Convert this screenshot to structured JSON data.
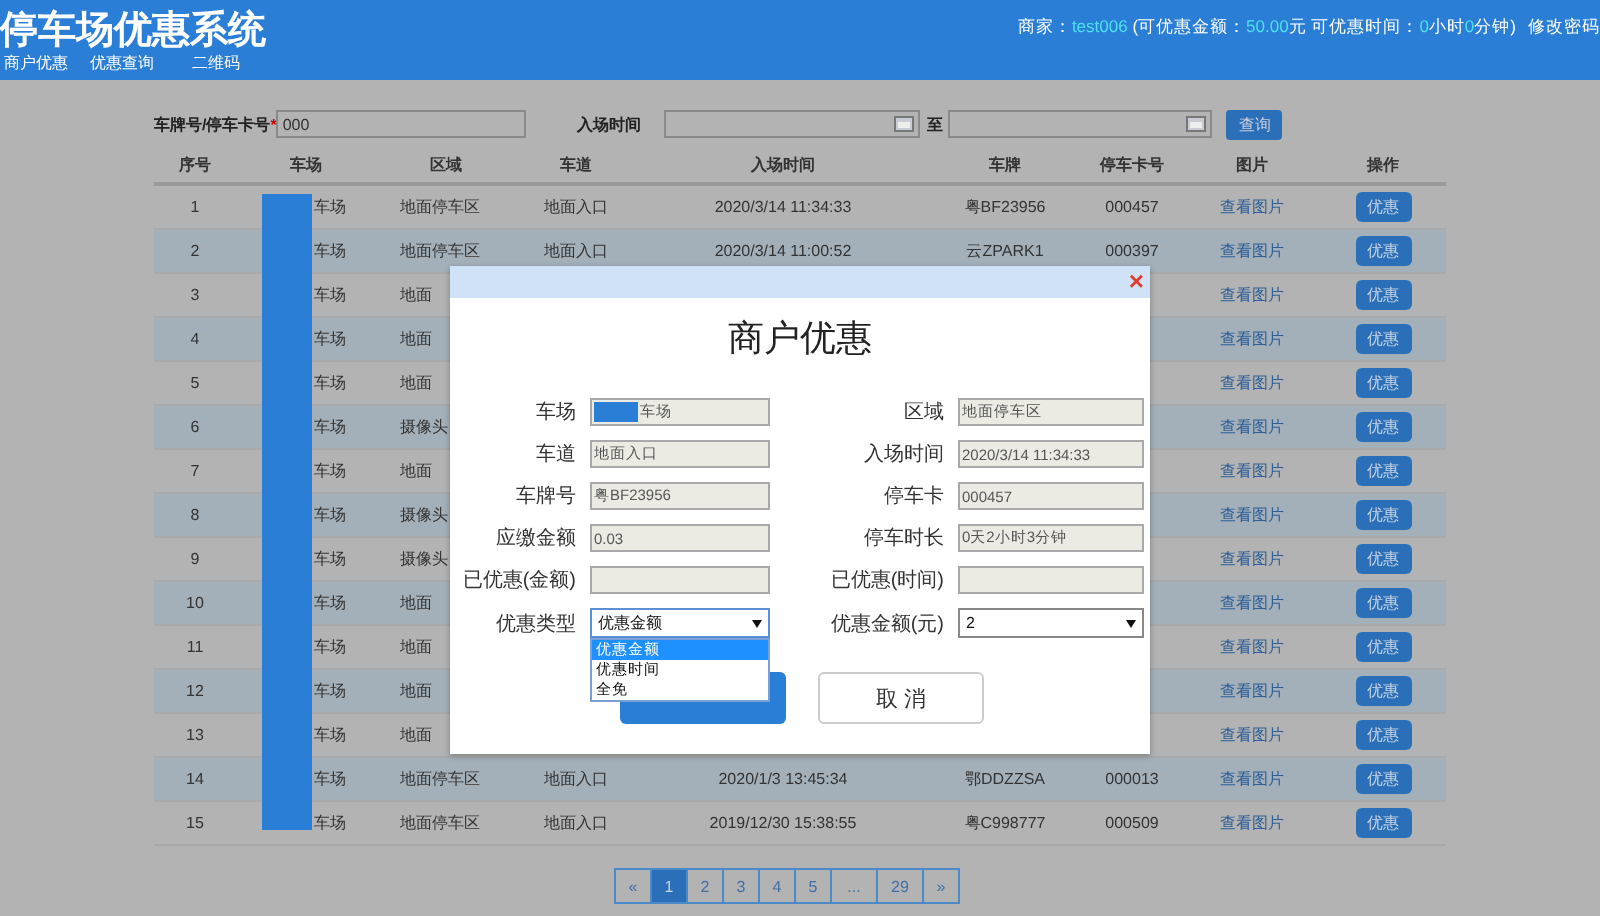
{
  "header": {
    "title": "停车场优惠系统",
    "info": [
      {
        "text": "商家：",
        "highlight": false
      },
      {
        "text": "test006",
        "highlight": true
      },
      {
        "text": " (可优惠金额：",
        "highlight": false
      },
      {
        "text": "50.00",
        "highlight": true
      },
      {
        "text": "元 可优惠时间：",
        "highlight": false
      },
      {
        "text": "0",
        "highlight": true
      },
      {
        "text": "小时",
        "highlight": false
      },
      {
        "text": "0",
        "highlight": true
      },
      {
        "text": "分钟)",
        "highlight": false
      }
    ],
    "change_password": "修改密码",
    "nav": [
      "商户优惠",
      "优惠查询",
      "二维码"
    ]
  },
  "search": {
    "plate_label": "车牌号/停车卡号",
    "required_mark": "*",
    "plate_value": "000",
    "time_label": "入场时间",
    "to_label": "至",
    "button": "查询"
  },
  "table": {
    "columns": [
      "序号",
      "车场",
      "区域",
      "车道",
      "入场时间",
      "车牌",
      "停车卡号",
      "图片",
      "操作"
    ],
    "rows": [
      {
        "no": "1",
        "lot": "车场",
        "area": "地面停车区",
        "lane": "地面入口",
        "time": "2020/3/14 11:34:33",
        "plate": "粤BF23956",
        "card": "000457",
        "picture": "查看图片",
        "action": "优惠"
      },
      {
        "no": "2",
        "lot": "车场",
        "area": "地面停车区",
        "lane": "地面入口",
        "time": "2020/3/14 11:00:52",
        "plate": "云ZPARK1",
        "card": "000397",
        "picture": "查看图片",
        "action": "优惠"
      },
      {
        "no": "3",
        "lot": "车场",
        "area": "地面",
        "picture": "查看图片",
        "action": "优惠"
      },
      {
        "no": "4",
        "lot": "车场",
        "area": "地面",
        "picture": "查看图片",
        "action": "优惠"
      },
      {
        "no": "5",
        "lot": "车场",
        "area": "地面",
        "picture": "查看图片",
        "action": "优惠"
      },
      {
        "no": "6",
        "lot": "车场",
        "area": "摄像头",
        "picture": "查看图片",
        "action": "优惠"
      },
      {
        "no": "7",
        "lot": "车场",
        "area": "地面",
        "picture": "查看图片",
        "action": "优惠"
      },
      {
        "no": "8",
        "lot": "车场",
        "area": "摄像头",
        "picture": "查看图片",
        "action": "优惠"
      },
      {
        "no": "9",
        "lot": "车场",
        "area": "摄像头",
        "picture": "查看图片",
        "action": "优惠"
      },
      {
        "no": "10",
        "lot": "车场",
        "area": "地面",
        "picture": "查看图片",
        "action": "优惠"
      },
      {
        "no": "11",
        "lot": "车场",
        "area": "地面",
        "picture": "查看图片",
        "action": "优惠"
      },
      {
        "no": "12",
        "lot": "车场",
        "area": "地面",
        "picture": "查看图片",
        "action": "优惠"
      },
      {
        "no": "13",
        "lot": "车场",
        "area": "地面",
        "picture": "查看图片",
        "action": "优惠"
      },
      {
        "no": "14",
        "lot": "车场",
        "area": "地面停车区",
        "lane": "地面入口",
        "time": "2020/1/3 13:45:34",
        "plate": "鄂DDZZSA",
        "card": "000013",
        "picture": "查看图片",
        "action": "优惠"
      },
      {
        "no": "15",
        "lot": "车场",
        "area": "地面停车区",
        "lane": "地面入口",
        "time": "2019/12/30 15:38:55",
        "plate": "粤C998777",
        "card": "000509",
        "picture": "查看图片",
        "action": "优惠"
      }
    ]
  },
  "pagination": {
    "prev": "«",
    "pages": [
      {
        "label": "1",
        "selected": true
      },
      {
        "label": "2",
        "selected": false
      },
      {
        "label": "3",
        "selected": false
      },
      {
        "label": "4",
        "selected": false
      },
      {
        "label": "5",
        "selected": false
      },
      {
        "label": "...",
        "selected": false
      },
      {
        "label": "29",
        "selected": false
      }
    ],
    "next": "»"
  },
  "dialog": {
    "close": "×",
    "title": "商户优惠",
    "fields": [
      {
        "label": "车场",
        "kind": "text",
        "value": "车场",
        "redacted": true
      },
      {
        "label": "区域",
        "kind": "text",
        "value": "地面停车区"
      },
      {
        "label": "车道",
        "kind": "text",
        "value": "地面入口"
      },
      {
        "label": "入场时间",
        "kind": "text",
        "value": "2020/3/14 11:34:33"
      },
      {
        "label": "车牌号",
        "kind": "text",
        "value": "粤BF23956"
      },
      {
        "label": "停车卡",
        "kind": "text",
        "value": "000457"
      },
      {
        "label": "应缴金额",
        "kind": "text",
        "value": "0.03"
      },
      {
        "label": "停车时长",
        "kind": "text",
        "value": "0天2小时3分钟"
      },
      {
        "label": "已优惠(金额)",
        "kind": "text"
      },
      {
        "label": "已优惠(时间)",
        "kind": "text"
      },
      {
        "label": "优惠类型",
        "kind": "select",
        "value": "优惠金额",
        "expanded": true,
        "options": [
          {
            "label": "优惠金额",
            "selected": true
          },
          {
            "label": "优惠时间",
            "selected": false
          },
          {
            "label": "全免",
            "selected": false
          }
        ]
      },
      {
        "label": "优惠金额(元)",
        "kind": "select",
        "value": "2",
        "expanded": false
      }
    ],
    "buttons": [
      {
        "kind": "primary"
      },
      {
        "label": "取 消",
        "kind": "secondary"
      }
    ]
  }
}
